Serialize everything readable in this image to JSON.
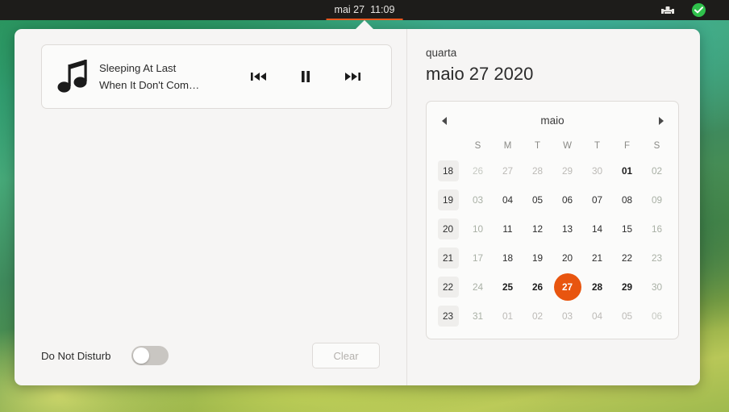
{
  "topbar": {
    "clock": "mai 27  11:09",
    "clock_date": "mai 27",
    "clock_time": "11:09",
    "accent_color": "#e8581f",
    "tray_icons": [
      "input-device-icon",
      "checkmark-badge-icon"
    ]
  },
  "media": {
    "icon": "music-note-icon",
    "title": "Sleeping At Last",
    "artist": "When It Don't Com…",
    "controls": {
      "previous": "previous-track-icon",
      "pause": "pause-icon",
      "next": "next-track-icon"
    }
  },
  "notifications": {
    "dnd_label": "Do Not Disturb",
    "dnd_enabled": false,
    "clear_label": "Clear"
  },
  "calendar": {
    "weekday_name": "quarta",
    "date_heading": "maio 27 2020",
    "month_label": "maio",
    "prev_icon": "chevron-left-icon",
    "next_icon": "chevron-right-icon",
    "today_color": "#e8550f",
    "weekday_headers": [
      "S",
      "M",
      "T",
      "W",
      "T",
      "F",
      "S"
    ],
    "weeks": [
      {
        "number": "18",
        "days": [
          {
            "n": "26",
            "state": "other",
            "weekend": true
          },
          {
            "n": "27",
            "state": "other",
            "weekend": false
          },
          {
            "n": "28",
            "state": "other",
            "weekend": false
          },
          {
            "n": "29",
            "state": "other",
            "weekend": false
          },
          {
            "n": "30",
            "state": "other",
            "weekend": false
          },
          {
            "n": "01",
            "state": "bold",
            "weekend": false
          },
          {
            "n": "02",
            "state": "normal",
            "weekend": true
          }
        ]
      },
      {
        "number": "19",
        "days": [
          {
            "n": "03",
            "state": "normal",
            "weekend": true
          },
          {
            "n": "04",
            "state": "normal",
            "weekend": false
          },
          {
            "n": "05",
            "state": "normal",
            "weekend": false
          },
          {
            "n": "06",
            "state": "normal",
            "weekend": false
          },
          {
            "n": "07",
            "state": "normal",
            "weekend": false
          },
          {
            "n": "08",
            "state": "normal",
            "weekend": false
          },
          {
            "n": "09",
            "state": "normal",
            "weekend": true
          }
        ]
      },
      {
        "number": "20",
        "days": [
          {
            "n": "10",
            "state": "normal",
            "weekend": true
          },
          {
            "n": "11",
            "state": "normal",
            "weekend": false
          },
          {
            "n": "12",
            "state": "normal",
            "weekend": false
          },
          {
            "n": "13",
            "state": "normal",
            "weekend": false
          },
          {
            "n": "14",
            "state": "normal",
            "weekend": false
          },
          {
            "n": "15",
            "state": "normal",
            "weekend": false
          },
          {
            "n": "16",
            "state": "normal",
            "weekend": true
          }
        ]
      },
      {
        "number": "21",
        "days": [
          {
            "n": "17",
            "state": "normal",
            "weekend": true
          },
          {
            "n": "18",
            "state": "normal",
            "weekend": false
          },
          {
            "n": "19",
            "state": "normal",
            "weekend": false
          },
          {
            "n": "20",
            "state": "normal",
            "weekend": false
          },
          {
            "n": "21",
            "state": "normal",
            "weekend": false
          },
          {
            "n": "22",
            "state": "normal",
            "weekend": false
          },
          {
            "n": "23",
            "state": "normal",
            "weekend": true
          }
        ]
      },
      {
        "number": "22",
        "days": [
          {
            "n": "24",
            "state": "normal",
            "weekend": true
          },
          {
            "n": "25",
            "state": "bold",
            "weekend": false
          },
          {
            "n": "26",
            "state": "bold",
            "weekend": false
          },
          {
            "n": "27",
            "state": "today",
            "weekend": false
          },
          {
            "n": "28",
            "state": "bold",
            "weekend": false
          },
          {
            "n": "29",
            "state": "bold",
            "weekend": false
          },
          {
            "n": "30",
            "state": "normal",
            "weekend": true
          }
        ]
      },
      {
        "number": "23",
        "days": [
          {
            "n": "31",
            "state": "normal",
            "weekend": true
          },
          {
            "n": "01",
            "state": "other",
            "weekend": false
          },
          {
            "n": "02",
            "state": "other",
            "weekend": false
          },
          {
            "n": "03",
            "state": "other",
            "weekend": false
          },
          {
            "n": "04",
            "state": "other",
            "weekend": false
          },
          {
            "n": "05",
            "state": "other",
            "weekend": false
          },
          {
            "n": "06",
            "state": "other",
            "weekend": true
          }
        ]
      }
    ]
  }
}
